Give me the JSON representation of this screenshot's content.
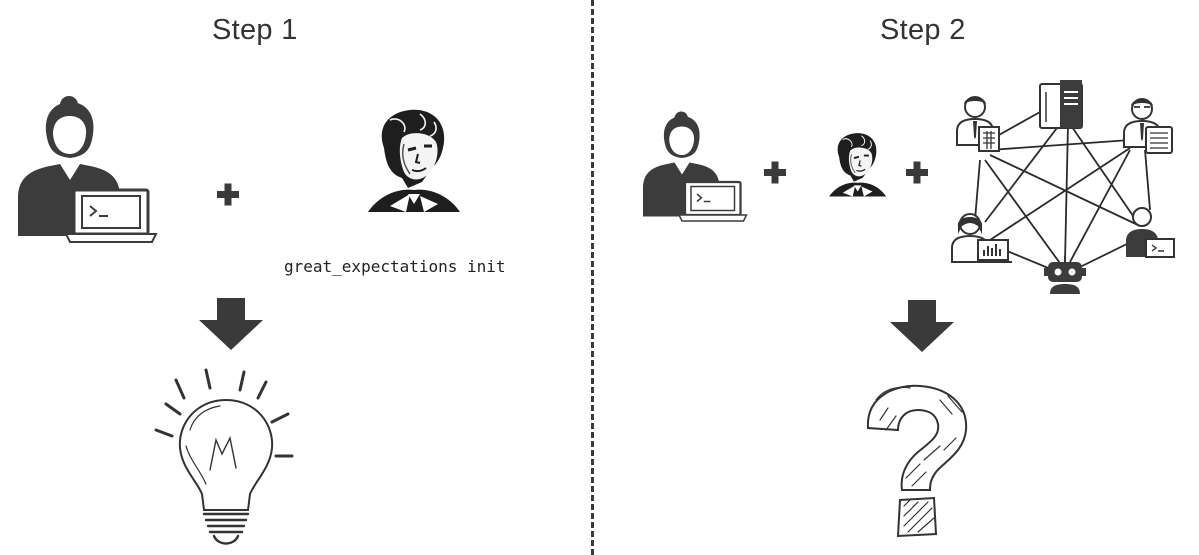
{
  "step1": {
    "title": "Step 1",
    "command": "great_expectations init",
    "result": "light-bulb-icon"
  },
  "step2": {
    "title": "Step 2",
    "result": "question-mark-icon",
    "network_nodes": [
      "analyst-icon",
      "server-icon",
      "reviewer-icon",
      "data-scientist-icon",
      "developer-icon",
      "robot-icon"
    ]
  },
  "colors": {
    "ink": "#333333",
    "fill": "#3c3c3c",
    "divider": "#3a3a3a"
  }
}
